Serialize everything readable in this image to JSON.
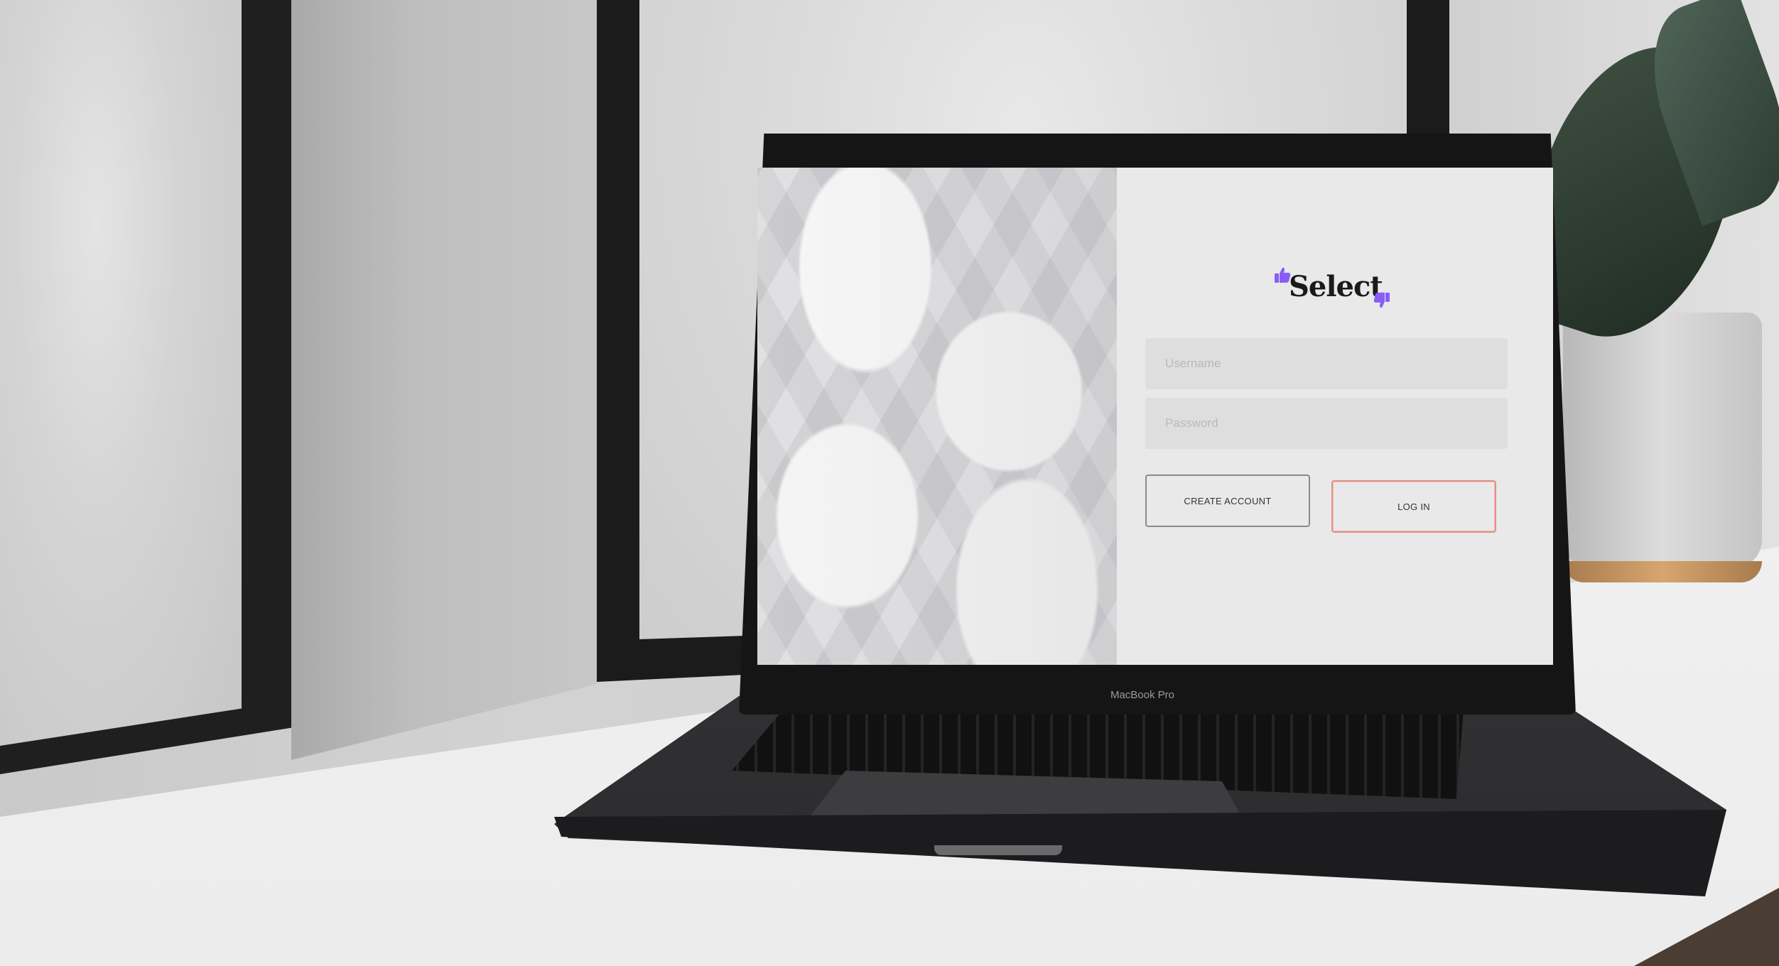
{
  "device": {
    "brand_label": "MacBook Pro"
  },
  "app": {
    "logo_text": "Select",
    "accent_color": "#8a5cf6",
    "username_placeholder": "Username",
    "password_placeholder": "Password",
    "create_account_label": "CREATE ACCOUNT",
    "login_label": "LOG IN",
    "login_border_color": "#e09090"
  }
}
